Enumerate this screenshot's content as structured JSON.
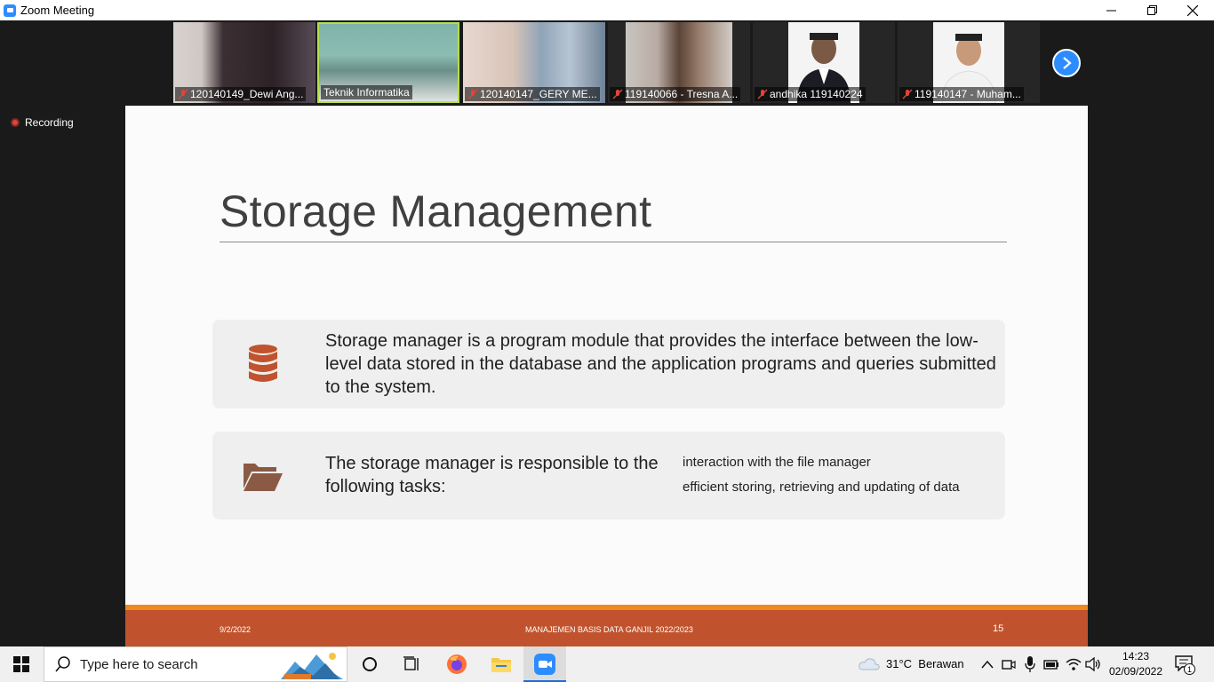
{
  "window": {
    "title": "Zoom Meeting",
    "minimize": "—",
    "restore": "❐",
    "close": "✕"
  },
  "participants": [
    {
      "name": "120140149_Dewi Ang...",
      "muted": true
    },
    {
      "name": "Teknik Informatika",
      "muted": false,
      "active": true
    },
    {
      "name": "120140147_GERY ME...",
      "muted": true
    },
    {
      "name": "119140066 - Tresna A...",
      "muted": true
    },
    {
      "name": "andhika 119140224",
      "muted": true
    },
    {
      "name": "119140147 - Muham...",
      "muted": true
    }
  ],
  "recording": {
    "label": "Recording"
  },
  "slide": {
    "title": "Storage Management",
    "card1_text": "Storage manager is a program module that provides the interface between the low-level data stored in the database and the application programs and queries submitted to the system.",
    "card2_text": "The storage manager is responsible to the following tasks:",
    "tasks": [
      "interaction with the file manager",
      "efficient storing, retrieving and updating of data"
    ],
    "footer_date": "9/2/2022",
    "footer_title": "MANAJEMEN BASIS DATA GANJIL 2022/2023",
    "page_number": "15",
    "icon_color": "#c0532d"
  },
  "taskbar": {
    "search_placeholder": "Type here to search",
    "weather": "31°C  Berawan",
    "time": "14:23",
    "date": "02/09/2022",
    "notification_count": "1"
  }
}
